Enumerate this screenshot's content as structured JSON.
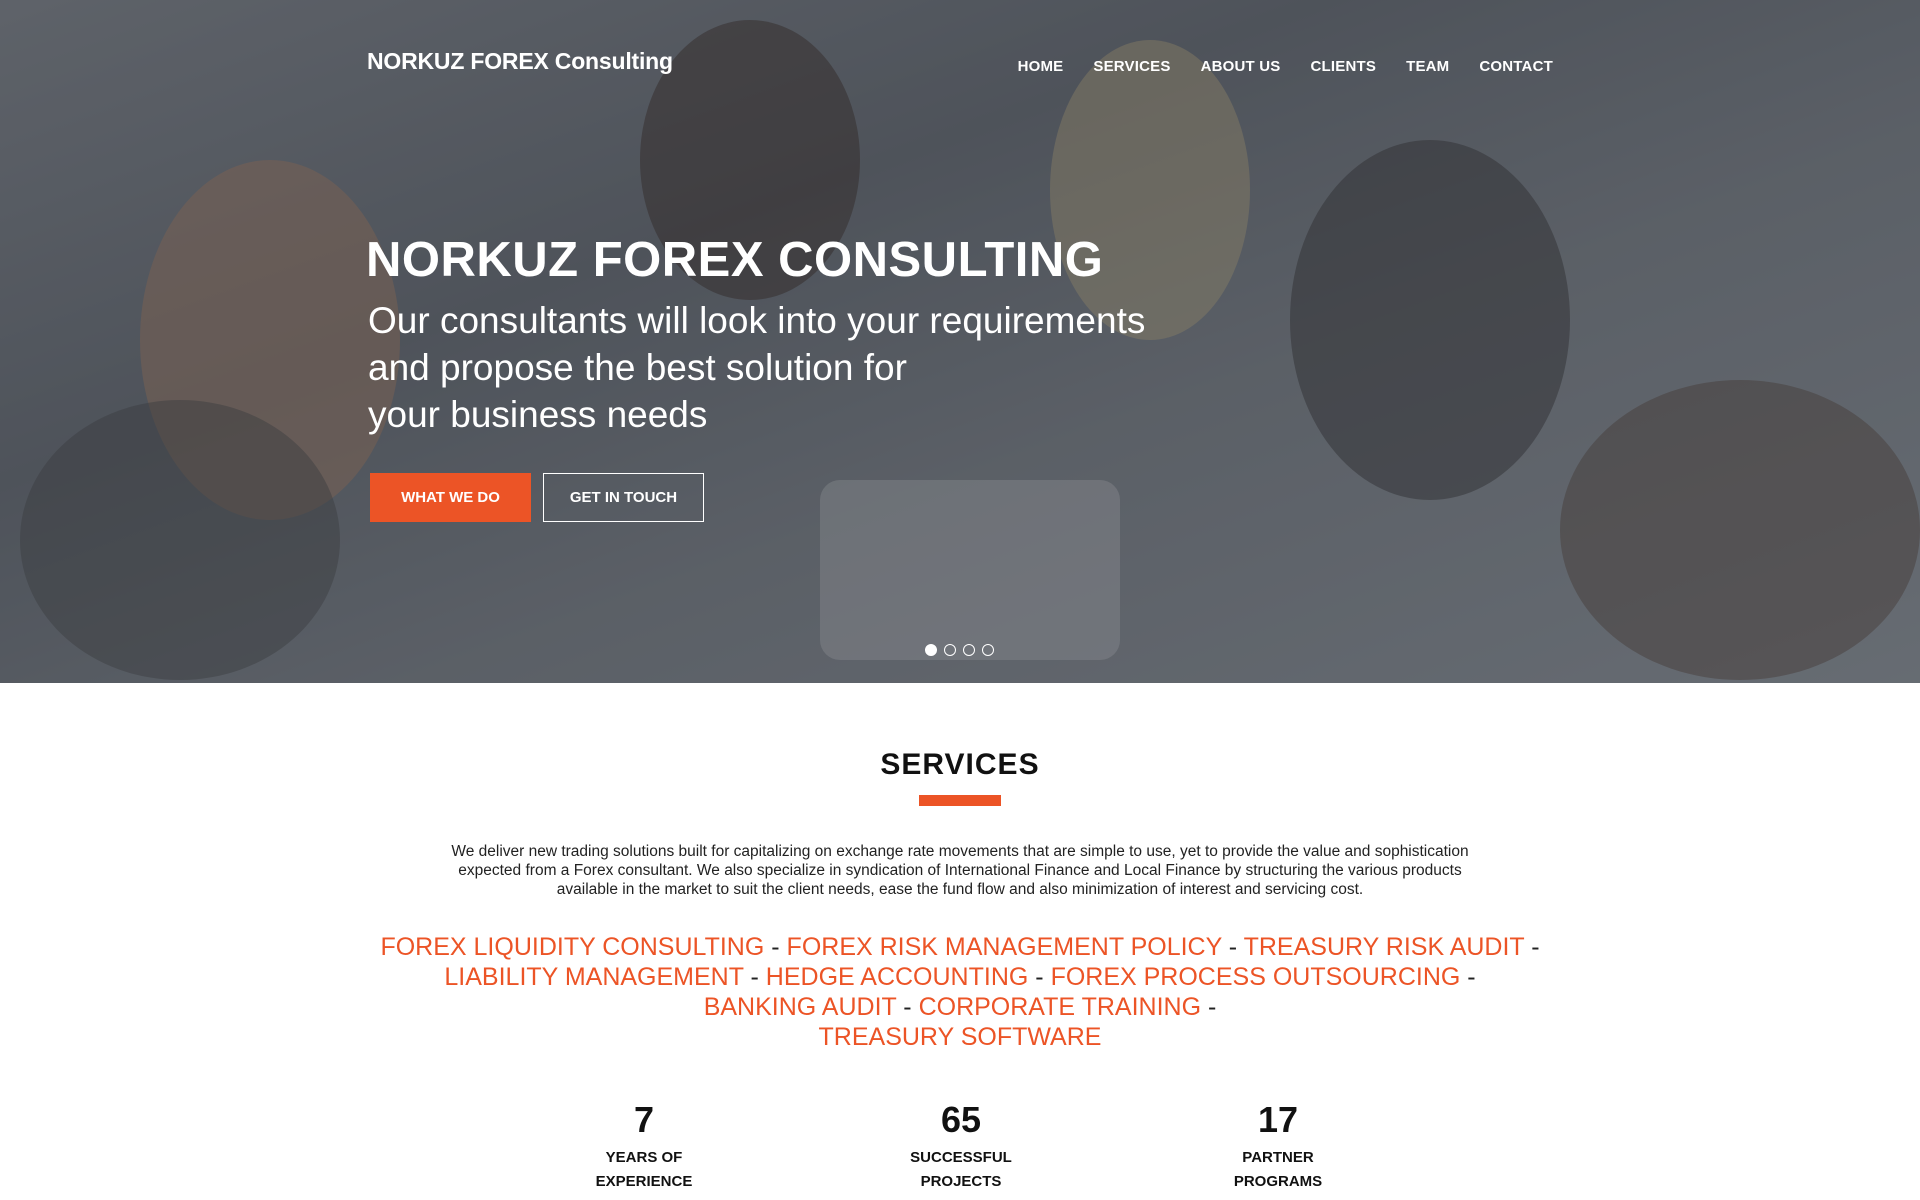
{
  "header": {
    "brand": "NORKUZ FOREX Consulting",
    "nav": [
      "HOME",
      "SERVICES",
      "ABOUT US",
      "CLIENTS",
      "TEAM",
      "CONTACT"
    ]
  },
  "hero": {
    "title": "NORKUZ FOREX CONSULTING",
    "subtitle_lines": [
      "Our consultants will look into your requirements",
      "and propose the best solution for",
      "your business needs"
    ],
    "primary_button": "WHAT WE DO",
    "secondary_button": "GET IN TOUCH",
    "slides": {
      "count": 4,
      "active": 1
    }
  },
  "services": {
    "title": "SERVICES",
    "description": "We deliver new trading solutions built for capitalizing on exchange rate movements that are simple to use, yet to provide the value and sophistication expected from a Forex consultant. We also specialize in syndication of International Finance and Local Finance by structuring the various products available in the market to suit the client needs, ease the fund flow and also minimization of interest and servicing cost.",
    "items": [
      "FOREX LIQUIDITY CONSULTING",
      "FOREX RISK MANAGEMENT POLICY",
      "TREASURY RISK AUDIT",
      "LIABILITY MANAGEMENT",
      "HEDGE ACCOUNTING",
      "FOREX PROCESS OUTSOURCING",
      "BANKING AUDIT",
      "CORPORATE TRAINING",
      "TREASURY SOFTWARE"
    ],
    "separator": "-"
  },
  "stats": [
    {
      "number": "7",
      "label_line1": "YEARS OF",
      "label_line2": "EXPERIENCE"
    },
    {
      "number": "65",
      "label_line1": "SUCCESSFUL",
      "label_line2": "PROJECTS"
    },
    {
      "number": "17",
      "label_line1": "PARTNER",
      "label_line2": "PROGRAMS"
    }
  ],
  "colors": {
    "accent": "#ec5426",
    "text": "#222222",
    "overlay": "#282c34"
  }
}
